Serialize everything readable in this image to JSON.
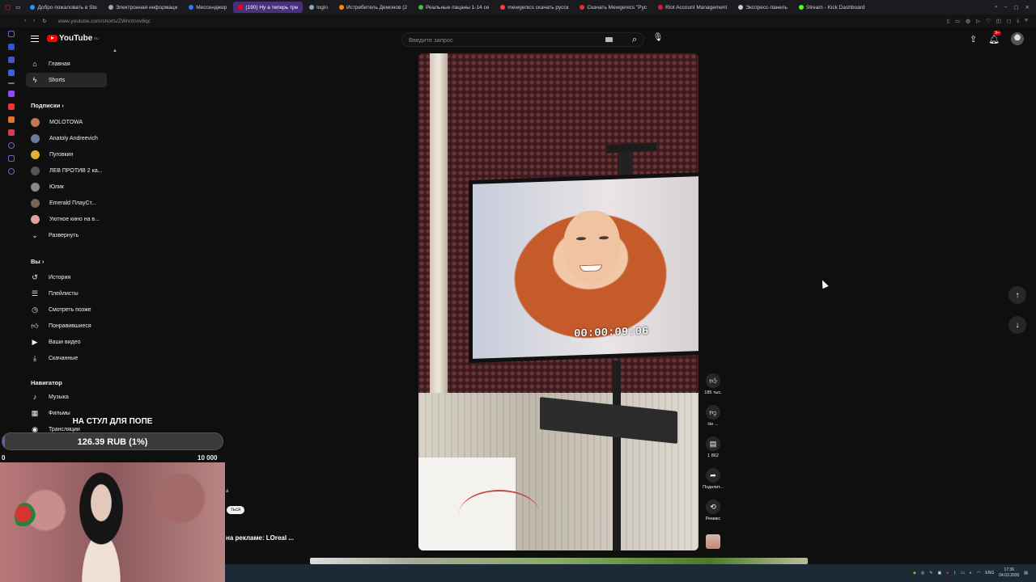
{
  "browser": {
    "tabs": [
      {
        "label": "Добро пожаловать в Ste",
        "color": "#1b9cfc"
      },
      {
        "label": "Электронная информаци",
        "color": "#9aa"
      },
      {
        "label": "Мессенджер",
        "color": "#2a7df0"
      },
      {
        "label": "(190) Ну а теперь тре",
        "color": "#ff0000",
        "active": true
      },
      {
        "label": "login",
        "color": "#8ab"
      },
      {
        "label": "Истребитель Демонов (2",
        "color": "#ff8800"
      },
      {
        "label": "Реальные пацаны 1-14 се",
        "color": "#44bb44"
      },
      {
        "label": "mewgenics скачать русск",
        "color": "#ff4040"
      },
      {
        "label": "Скачать Mewgenics \"Рус",
        "color": "#dd3333"
      },
      {
        "label": "Riot Account Management",
        "color": "#cc2233"
      },
      {
        "label": "Экспресс-панель",
        "color": "#ccc"
      },
      {
        "label": "Stream - Kick Dashboard",
        "color": "#53fc18"
      }
    ],
    "url": "www.youtube.com/shorts/ZWnrznnv6qc"
  },
  "youtube": {
    "logo_text": "YouTube",
    "logo_region": "RU",
    "search_placeholder": "Введите запрос",
    "notif_count": "9+",
    "nav": {
      "home": "Главная",
      "shorts": "Shorts"
    },
    "subscriptions_title": "Подписки",
    "subscriptions": [
      {
        "name": "MOLOTOWA",
        "color": "#c07a5a"
      },
      {
        "name": "Anatoly Andreevich",
        "color": "#6a7a9a"
      },
      {
        "name": "Пуговкин",
        "color": "#e0b030"
      },
      {
        "name": "ЛЕВ ПРОТИВ 2 ка...",
        "color": "#555"
      },
      {
        "name": "Юлик",
        "color": "#888"
      },
      {
        "name": "Emerald ПлауСт...",
        "color": "#776655"
      },
      {
        "name": "Уютное кино на в...",
        "color": "#e4a0a0"
      }
    ],
    "expand": "Развернуть",
    "you_title": "Вы",
    "you_items": [
      "История",
      "Плейлисты",
      "Смотреть позже",
      "Понравившиеся",
      "Ваши видео",
      "Скачанные"
    ],
    "navigator_title": "Навигатор",
    "navigator_items": [
      "Музыка",
      "Фильмы",
      "Трансляции"
    ]
  },
  "short": {
    "timer": "00:00:09:06",
    "likes": "185 тыс.",
    "dislike": "Не ...",
    "comments": "1 862",
    "share": "Поделит...",
    "remix": "Ремикс"
  },
  "overlay": {
    "goal_title": "НА СТУЛ ДЛЯ ПОПЕ",
    "goal_text": "126.39 RUB (1%)",
    "goal_fraction": 0.0126,
    "goal_min": "0",
    "goal_max": "10 000",
    "snippet_top": "а",
    "snippet_btn": "ться",
    "ad_text": "на рекламе: LOreal ..."
  },
  "taskbar": {
    "lang": "ENG",
    "time": "17:36",
    "date": "04.03.2026"
  }
}
